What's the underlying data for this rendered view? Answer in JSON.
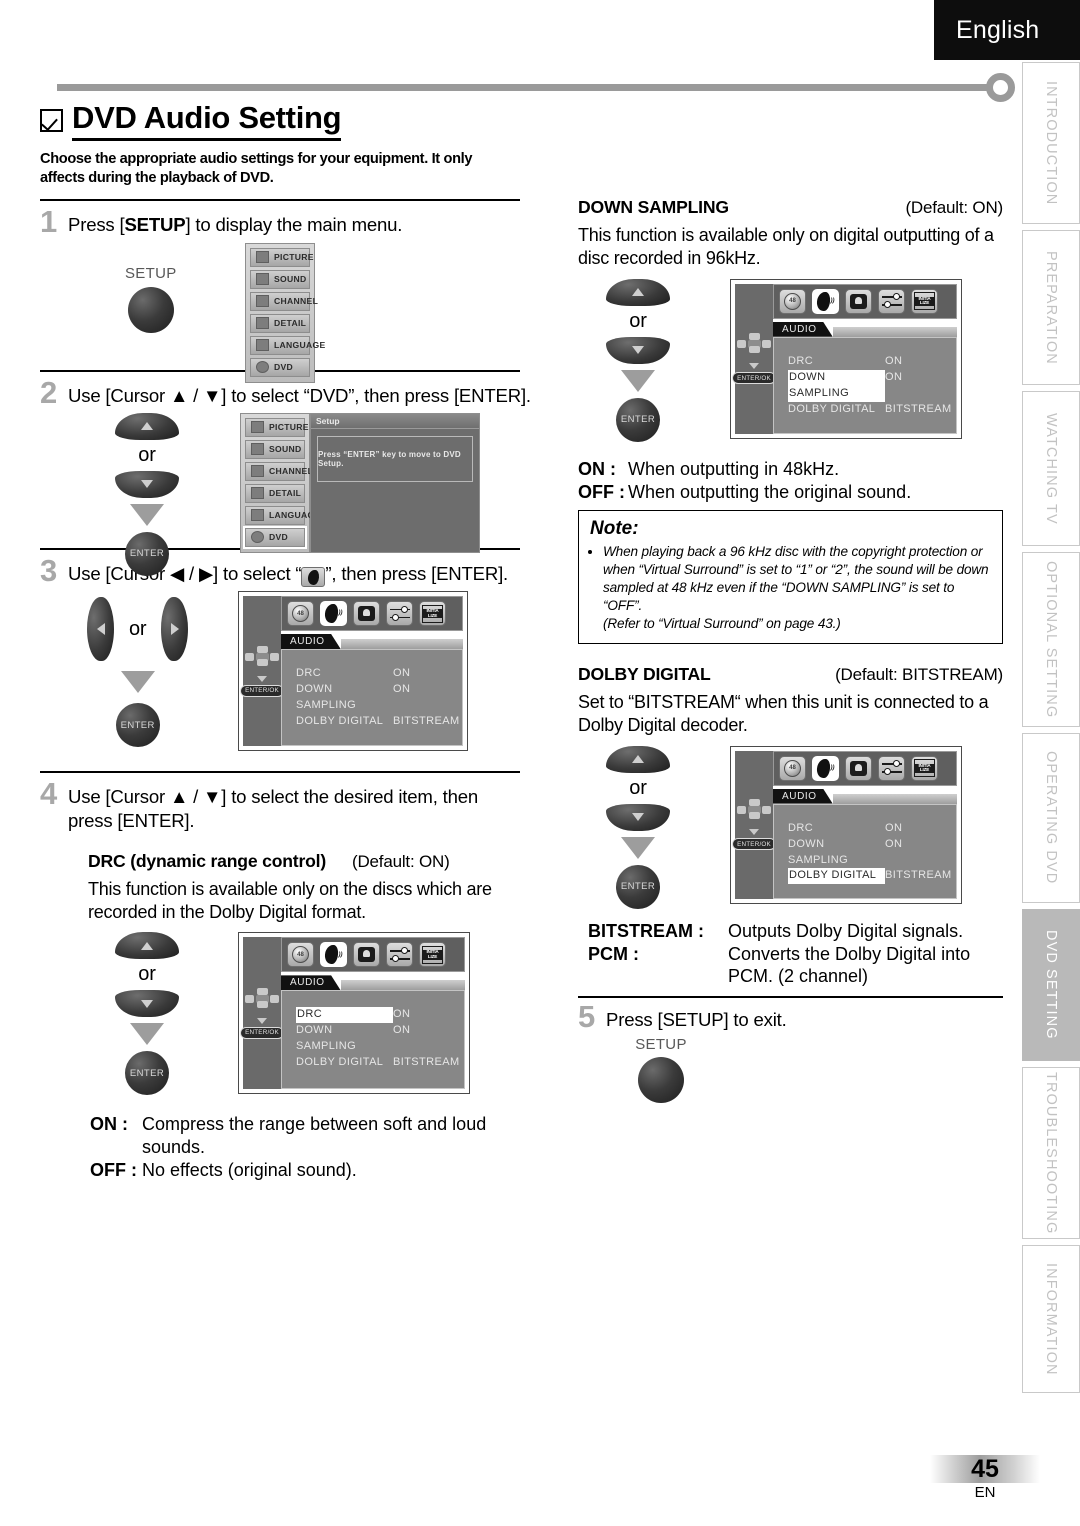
{
  "header": {
    "language": "English"
  },
  "sidebar": {
    "tabs": [
      {
        "label": "INTRODUCTION",
        "active": false
      },
      {
        "label": "PREPARATION",
        "active": false
      },
      {
        "label": "WATCHING TV",
        "active": false
      },
      {
        "label": "OPTIONAL SETTING",
        "active": false
      },
      {
        "label": "OPERATING DVD",
        "active": false
      },
      {
        "label": "DVD SETTING",
        "active": true
      },
      {
        "label": "TROUBLESHOOTING",
        "active": false
      },
      {
        "label": "INFORMATION",
        "active": false
      }
    ]
  },
  "page": {
    "title": "DVD Audio Setting",
    "subtitle": "Choose the appropriate audio settings for your equipment. It only affects during the playback of DVD.",
    "number": "45",
    "lang_code": "EN"
  },
  "steps": {
    "s1": {
      "num": "1",
      "text_pre": "Press [",
      "bold": "SETUP",
      "text_post": "] to display the main menu."
    },
    "s2": {
      "num": "2",
      "text": "Use [Cursor ▲ / ▼] to select “DVD”, then press [ENTER]."
    },
    "s3": {
      "num": "3",
      "text_a": "Use [Cursor ◀ / ▶] to select “",
      "text_b": "”, then press [ENTER]."
    },
    "s4": {
      "num": "4",
      "text": "Use [Cursor ▲ / ▼] to select the desired item, then press [ENTER]."
    },
    "s5": {
      "num": "5",
      "text": "Press [SETUP] to exit."
    }
  },
  "remote": {
    "setup_label": "SETUP",
    "enter_label": "ENTER",
    "or_label": "or"
  },
  "tv_menu": {
    "items": [
      "PICTURE",
      "SOUND",
      "CHANNEL",
      "DETAIL",
      "LANGUAGE",
      "DVD"
    ],
    "selected": "DVD",
    "panel_title": "Setup",
    "panel_message": "Press “ENTER” key to move to DVD Setup."
  },
  "osd": {
    "tab_label": "AUDIO",
    "enter_ok": "ENTER/OK",
    "icons": [
      "disc-48-icon",
      "speaker-audio-icon",
      "lock-parental-icon",
      "sliders-others-icon",
      "initialize-icon"
    ],
    "rows": [
      {
        "key": "DRC",
        "value": "ON"
      },
      {
        "key": "DOWN SAMPLING",
        "value": "ON"
      },
      {
        "key": "DOLBY DIGITAL",
        "value": "BITSTREAM"
      }
    ],
    "highlight_step3": "",
    "highlight_drc": "DRC",
    "highlight_down_sampling": "DOWN SAMPLING",
    "highlight_dolby_digital": "DOLBY DIGITAL"
  },
  "sections": {
    "drc": {
      "name": "DRC (dynamic range control)",
      "default": "(Default: ON)",
      "body": "This function is available only on the discs which are recorded in the Dolby Digital format.",
      "options": [
        {
          "key": "ON :",
          "value": "Compress the range between soft and loud sounds."
        },
        {
          "key": "OFF :",
          "value": "No effects (original sound)."
        }
      ]
    },
    "down_sampling": {
      "name": "DOWN SAMPLING",
      "default": "(Default: ON)",
      "body": "This function is available only on digital outputting of a disc recorded in 96kHz.",
      "options": [
        {
          "key": "ON :",
          "value": "When outputting in 48kHz."
        },
        {
          "key": "OFF :",
          "value": "When outputting the original sound."
        }
      ]
    },
    "dolby_digital": {
      "name": "DOLBY DIGITAL",
      "default": "(Default: BITSTREAM)",
      "body": "Set to “BITSTREAM“ when this unit is connected to a Dolby Digital decoder.",
      "options": [
        {
          "key": "BITSTREAM :",
          "value": "Outputs Dolby Digital signals."
        },
        {
          "key": "PCM :",
          "value": "Converts the Dolby Digital into PCM. (2 channel)"
        }
      ]
    }
  },
  "note": {
    "title": "Note:",
    "body": "When playing back a 96 kHz disc with the copyright protection or when “Virtual Surround” is set to “1” or “2”, the sound will be down sampled at 48 kHz even if the “DOWN SAMPLING” is set to “OFF”.",
    "refer": "(Refer to “Virtual Surround” on page 43.)"
  }
}
